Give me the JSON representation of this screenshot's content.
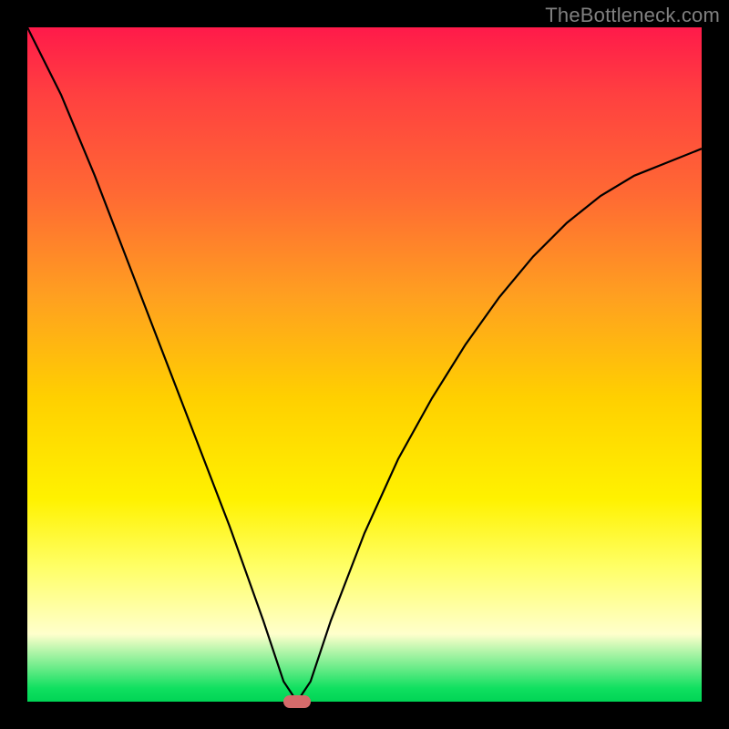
{
  "watermark": "TheBottleneck.com",
  "chart_data": {
    "type": "line",
    "title": "",
    "xlabel": "",
    "ylabel": "",
    "xlim": [
      0,
      1
    ],
    "ylim": [
      0,
      1
    ],
    "marker": {
      "x": 0.4,
      "y": 0.0
    },
    "series": [
      {
        "name": "curve",
        "x": [
          0.0,
          0.05,
          0.1,
          0.15,
          0.2,
          0.25,
          0.3,
          0.35,
          0.38,
          0.4,
          0.42,
          0.45,
          0.5,
          0.55,
          0.6,
          0.65,
          0.7,
          0.75,
          0.8,
          0.85,
          0.9,
          0.95,
          1.0
        ],
        "y": [
          1.0,
          0.9,
          0.78,
          0.65,
          0.52,
          0.39,
          0.26,
          0.12,
          0.03,
          0.0,
          0.03,
          0.12,
          0.25,
          0.36,
          0.45,
          0.53,
          0.6,
          0.66,
          0.71,
          0.75,
          0.78,
          0.8,
          0.82
        ]
      }
    ],
    "gradient_stops": [
      {
        "pos": 0.0,
        "color": "#ff1a4a"
      },
      {
        "pos": 0.25,
        "color": "#ff6a33"
      },
      {
        "pos": 0.55,
        "color": "#ffd000"
      },
      {
        "pos": 0.8,
        "color": "#ffff66"
      },
      {
        "pos": 0.98,
        "color": "#10e060"
      },
      {
        "pos": 1.0,
        "color": "#00d455"
      }
    ]
  }
}
